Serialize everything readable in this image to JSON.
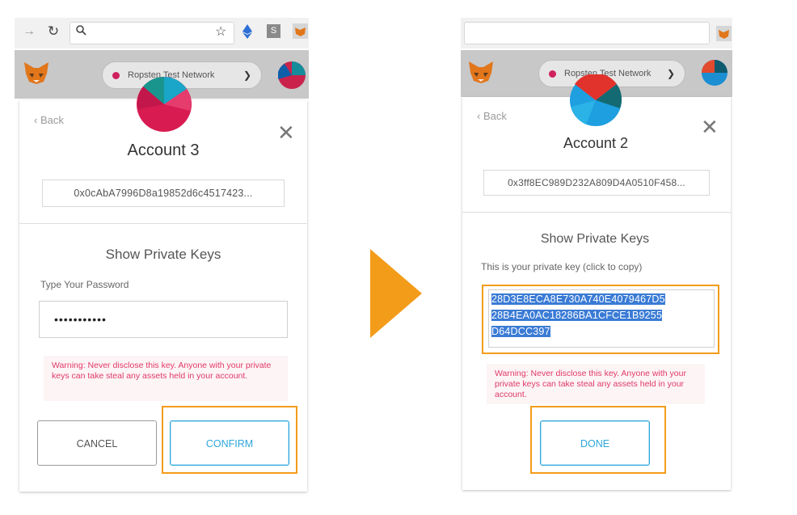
{
  "colors": {
    "accent_orange": "#f39c1a",
    "primary_blue": "#2ea6da",
    "warning_red": "#e03a67",
    "network_dot": "#d0215e"
  },
  "left": {
    "network": "Ropsten Test Network",
    "back": "Back",
    "account_name": "Account 3",
    "address": "0x0cAbA7996D8a19852d6c4517423...",
    "section_title": "Show Private Keys",
    "password_label": "Type Your Password",
    "password_value": "•••••••••••",
    "warning": "Warning: Never disclose this key. Anyone with your private keys can take steal any assets held in your account.",
    "cancel": "CANCEL",
    "confirm": "CONFIRM"
  },
  "right": {
    "network": "Ropsten Test Network",
    "back": "Back",
    "account_name": "Account 2",
    "address": "0x3ff8EC989D232A809D4A0510F458...",
    "section_title": "Show Private Keys",
    "copy_hint": "This is your private key (click to copy)",
    "private_key_line1": "28D3E8ECA8E730A740E4079467D5",
    "private_key_line2": "28B4EA0AC18286BA1CFCE1B9255",
    "private_key_line3": "D64DCC397",
    "warning": "Warning: Never disclose this key. Anyone with your private keys can take steal any assets held in your account.",
    "done": "DONE"
  }
}
